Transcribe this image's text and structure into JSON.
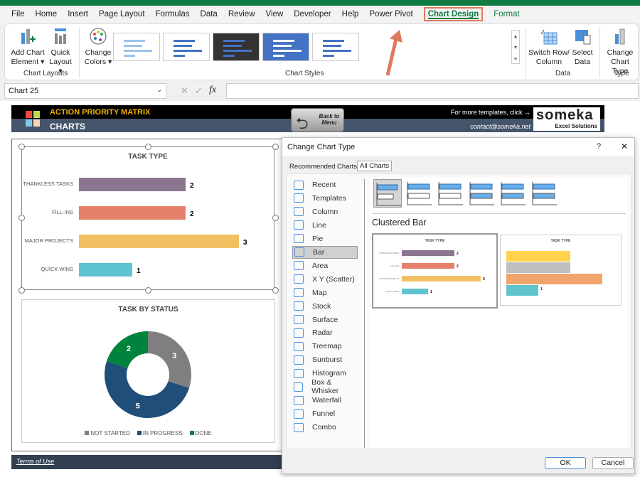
{
  "menu": {
    "tabs": [
      "File",
      "Home",
      "Insert",
      "Page Layout",
      "Formulas",
      "Data",
      "Review",
      "View",
      "Developer",
      "Help",
      "Power Pivot",
      "Chart Design",
      "Format"
    ],
    "active": "Chart Design"
  },
  "ribbon": {
    "add_chart_element": [
      "Add Chart",
      "Element ▾"
    ],
    "quick_layout": [
      "Quick",
      "Layout ▾"
    ],
    "change_colors": [
      "Change",
      "Colors ▾"
    ],
    "switch_row_column": [
      "Switch Row/",
      "Column"
    ],
    "select_data": [
      "Select",
      "Data"
    ],
    "change_chart_type": [
      "Change",
      "Chart Type"
    ],
    "groups": {
      "chart_layouts": "Chart Layouts",
      "chart_styles": "Chart Styles",
      "data": "Data",
      "type": "Type"
    }
  },
  "formula_bar": {
    "name_box": "Chart 25",
    "fx": "fx",
    "cancel": "✕",
    "enter": "✓",
    "value": ""
  },
  "banner": {
    "app_title": "ACTION PRIORITY MATRIX",
    "section": "CHARTS",
    "back_line1": "Back to",
    "back_line2": "Menu",
    "more_templates": "For more templates, click →",
    "contact": "contact@someka.net",
    "logo_name": "someka",
    "logo_tag": "Excel Solutions"
  },
  "footer": {
    "terms": "Terms of Use"
  },
  "chart_data": [
    {
      "type": "bar",
      "title": "TASK TYPE",
      "categories": [
        "THANKLESS TASKS",
        "FİLL-INS",
        "MAJOR PROJECTS",
        "QUİCK WİNS"
      ],
      "values": [
        2,
        2,
        3,
        1
      ],
      "colors": [
        "#8c7590",
        "#e5806a",
        "#f2c063",
        "#60c4d0"
      ],
      "xlim": [
        0,
        3
      ]
    },
    {
      "type": "pie",
      "title": "TASK BY STATUS",
      "donut": true,
      "categories": [
        "NOT STARTED",
        "IN PROGRESS",
        "DONE"
      ],
      "values": [
        3,
        5,
        2
      ],
      "colors": [
        "#7f7f7f",
        "#1f4e79",
        "#00843d"
      ],
      "legend": "bottom"
    }
  ],
  "dialog": {
    "title": "Change Chart Type",
    "help": "?",
    "close": "✕",
    "tabs": [
      "Recommended Charts",
      "All Charts"
    ],
    "active_tab": "All Charts",
    "chart_types": [
      "Recent",
      "Templates",
      "Column",
      "Line",
      "Pie",
      "Bar",
      "Area",
      "X Y (Scatter)",
      "Map",
      "Stock",
      "Surface",
      "Radar",
      "Treemap",
      "Sunburst",
      "Histogram",
      "Box & Whisker",
      "Waterfall",
      "Funnel",
      "Combo"
    ],
    "selected_type": "Bar",
    "subtype_title": "Clustered Bar",
    "preview_title": "TASK TYPE",
    "preview2_label": "1",
    "ok": "OK",
    "cancel": "Cancel"
  }
}
